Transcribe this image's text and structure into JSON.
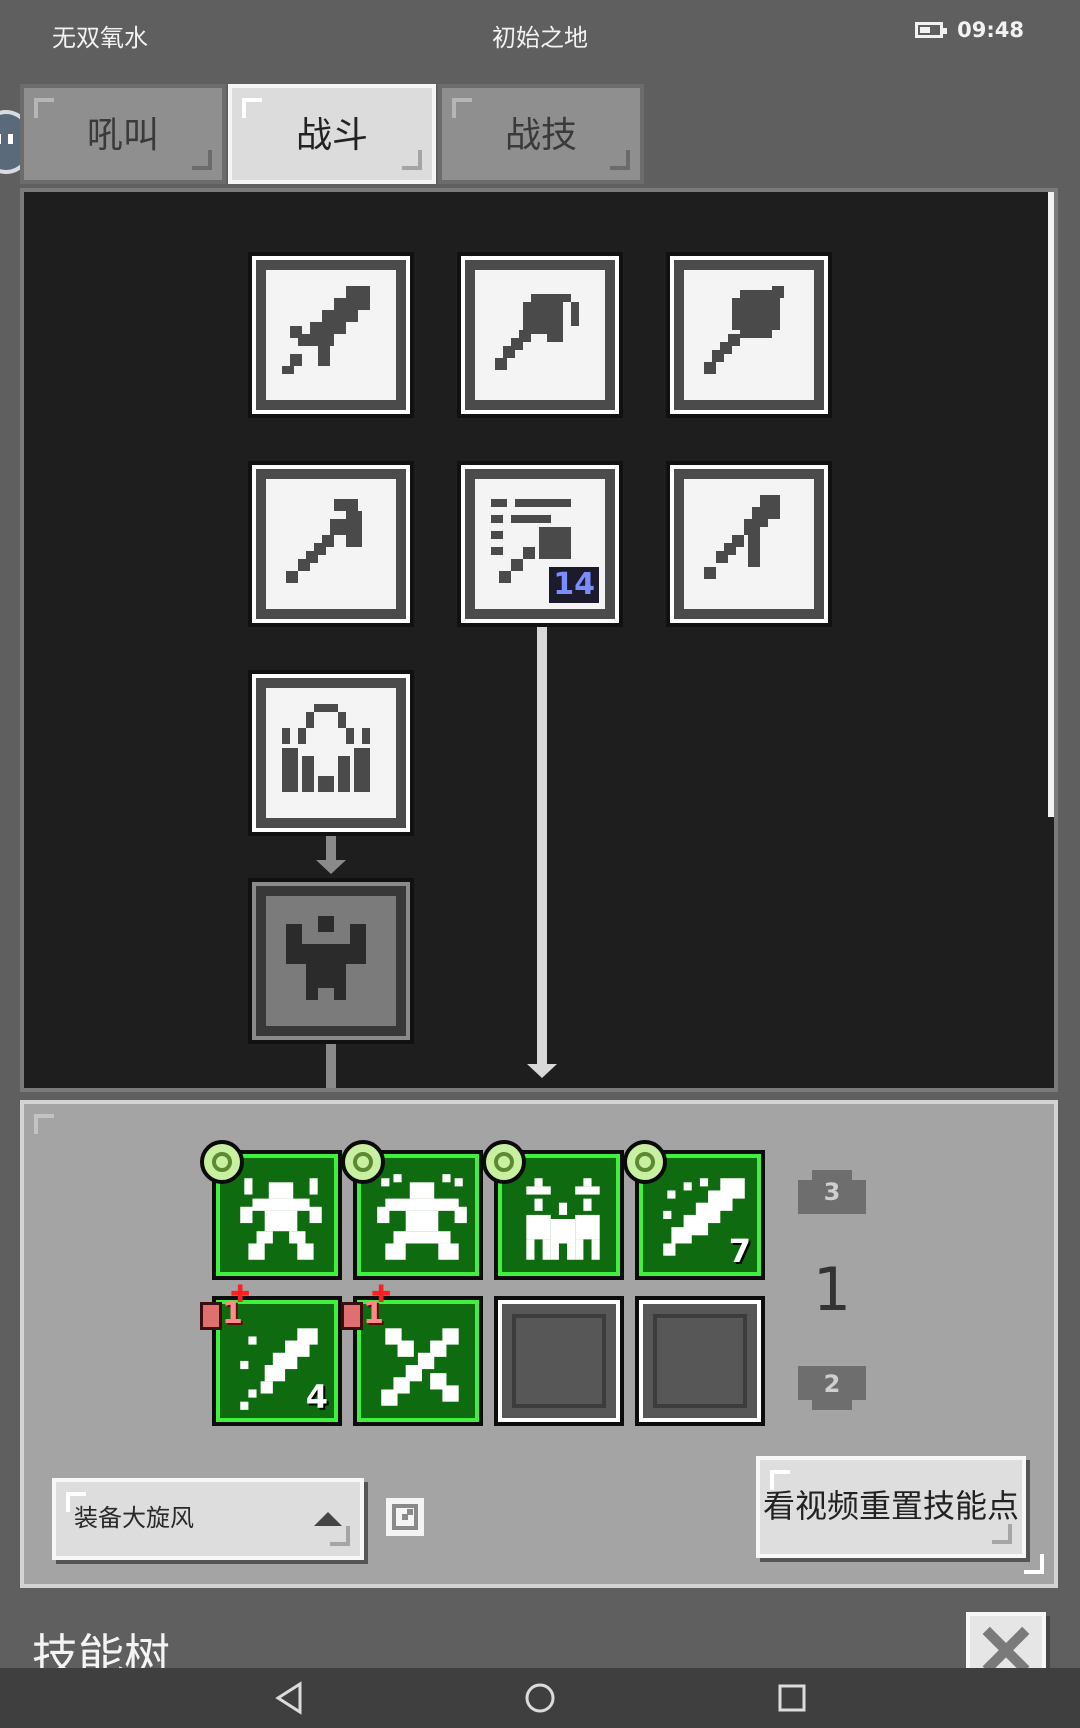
{
  "status_bar": {
    "left_text": "无双氧水",
    "center_text": "初始之地",
    "time": "09:48"
  },
  "tabs": [
    {
      "label": "吼叫",
      "active": false
    },
    {
      "label": "战斗",
      "active": true
    },
    {
      "label": "战技",
      "active": false
    }
  ],
  "skill_tree": {
    "nodes": [
      {
        "icon": "sword-icon"
      },
      {
        "icon": "axe-icon"
      },
      {
        "icon": "mace-icon"
      },
      {
        "icon": "halberd-icon"
      },
      {
        "icon": "axe-mastery-icon",
        "level": "14"
      },
      {
        "icon": "spear-icon"
      },
      {
        "icon": "ghost-armor-icon"
      },
      {
        "icon": "strongman-icon",
        "locked": true
      }
    ]
  },
  "equipped": {
    "slots": [
      {
        "icon": "rage-warrior-icon",
        "ring": true
      },
      {
        "icon": "war-cry-icon",
        "ring": true
      },
      {
        "icon": "rally-icon",
        "ring": true
      },
      {
        "icon": "greatsword-icon",
        "ring": true,
        "level": "7"
      },
      {
        "icon": "feather-blade-icon",
        "badge": "1",
        "level": "4"
      },
      {
        "icon": "crossed-swords-icon",
        "badge": "1"
      },
      {
        "icon": "empty-slot",
        "empty": true
      },
      {
        "icon": "empty-slot",
        "empty": true
      }
    ],
    "page_up": "3",
    "page_current": "1",
    "page_down": "2",
    "equip_button": "装备大旋风",
    "reset_button": "看视频重置技能点"
  },
  "footer": {
    "title": "技能树"
  },
  "colors": {
    "tree_bg": "#1e1e1e",
    "panel_bg": "#a4a4a4",
    "slot_green": "#3ff03f",
    "level_blue": "#7b8cff"
  }
}
